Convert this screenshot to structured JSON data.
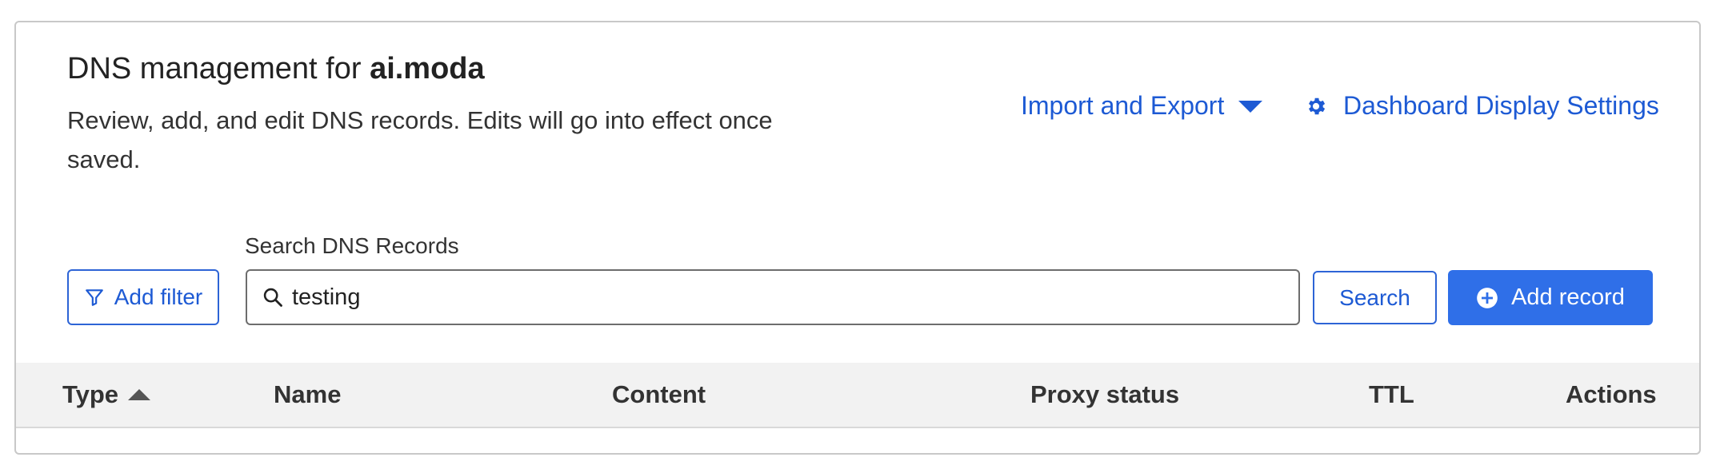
{
  "header": {
    "title_prefix": "DNS management for ",
    "domain": "ai.moda",
    "description": "Review, add, and edit DNS records. Edits will go into effect once saved."
  },
  "actions": {
    "import_export_label": "Import and Export",
    "dashboard_settings_label": "Dashboard Display Settings"
  },
  "search": {
    "label": "Search DNS Records",
    "value": "testing",
    "button_label": "Search"
  },
  "filter": {
    "add_filter_label": "Add filter"
  },
  "add_record": {
    "label": "Add record"
  },
  "table": {
    "columns": {
      "type": "Type",
      "name": "Name",
      "content": "Content",
      "proxy_status": "Proxy status",
      "ttl": "TTL",
      "actions": "Actions"
    }
  },
  "colors": {
    "accent": "#1d5ad4",
    "primary_button": "#2f6fe8",
    "header_bg": "#f2f2f2"
  }
}
